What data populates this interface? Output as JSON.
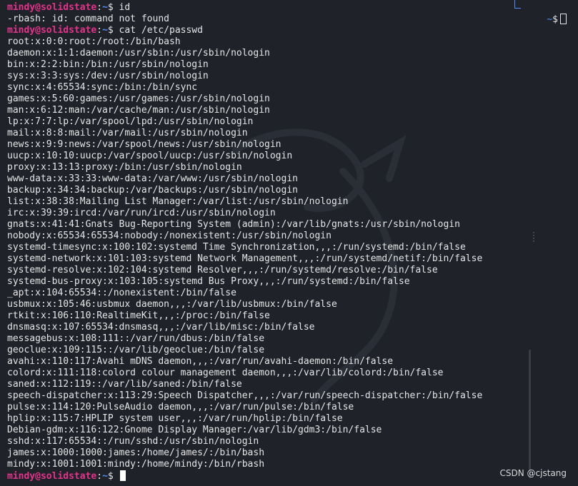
{
  "colors": {
    "background": "#1f2229",
    "prompt_user": "#e3338b",
    "prompt_path": "#4f8cf4",
    "text": "#e6e6e6"
  },
  "prompt": {
    "user": "mindy",
    "at": "@",
    "host": "solidstate",
    "colon": ":",
    "path": "~",
    "symbol": "$"
  },
  "top_right_prompt": {
    "path": "~",
    "symbol": "$"
  },
  "session": [
    {
      "kind": "prompt",
      "command": " id"
    },
    {
      "kind": "output",
      "text": "-rbash: id: command not found"
    },
    {
      "kind": "prompt",
      "command": " cat /etc/passwd"
    },
    {
      "kind": "output",
      "text": "root:x:0:0:root:/root:/bin/bash"
    },
    {
      "kind": "output",
      "text": "daemon:x:1:1:daemon:/usr/sbin:/usr/sbin/nologin"
    },
    {
      "kind": "output",
      "text": "bin:x:2:2:bin:/bin:/usr/sbin/nologin"
    },
    {
      "kind": "output",
      "text": "sys:x:3:3:sys:/dev:/usr/sbin/nologin"
    },
    {
      "kind": "output",
      "text": "sync:x:4:65534:sync:/bin:/bin/sync"
    },
    {
      "kind": "output",
      "text": "games:x:5:60:games:/usr/games:/usr/sbin/nologin"
    },
    {
      "kind": "output",
      "text": "man:x:6:12:man:/var/cache/man:/usr/sbin/nologin"
    },
    {
      "kind": "output",
      "text": "lp:x:7:7:lp:/var/spool/lpd:/usr/sbin/nologin"
    },
    {
      "kind": "output",
      "text": "mail:x:8:8:mail:/var/mail:/usr/sbin/nologin"
    },
    {
      "kind": "output",
      "text": "news:x:9:9:news:/var/spool/news:/usr/sbin/nologin"
    },
    {
      "kind": "output",
      "text": "uucp:x:10:10:uucp:/var/spool/uucp:/usr/sbin/nologin"
    },
    {
      "kind": "output",
      "text": "proxy:x:13:13:proxy:/bin:/usr/sbin/nologin"
    },
    {
      "kind": "output",
      "text": "www-data:x:33:33:www-data:/var/www:/usr/sbin/nologin"
    },
    {
      "kind": "output",
      "text": "backup:x:34:34:backup:/var/backups:/usr/sbin/nologin"
    },
    {
      "kind": "output",
      "text": "list:x:38:38:Mailing List Manager:/var/list:/usr/sbin/nologin"
    },
    {
      "kind": "output",
      "text": "irc:x:39:39:ircd:/var/run/ircd:/usr/sbin/nologin"
    },
    {
      "kind": "output",
      "text": "gnats:x:41:41:Gnats Bug-Reporting System (admin):/var/lib/gnats:/usr/sbin/nologin"
    },
    {
      "kind": "output",
      "text": "nobody:x:65534:65534:nobody:/nonexistent:/usr/sbin/nologin"
    },
    {
      "kind": "output",
      "text": "systemd-timesync:x:100:102:systemd Time Synchronization,,,:/run/systemd:/bin/false"
    },
    {
      "kind": "output",
      "text": "systemd-network:x:101:103:systemd Network Management,,,:/run/systemd/netif:/bin/false"
    },
    {
      "kind": "output",
      "text": "systemd-resolve:x:102:104:systemd Resolver,,,:/run/systemd/resolve:/bin/false"
    },
    {
      "kind": "output",
      "text": "systemd-bus-proxy:x:103:105:systemd Bus Proxy,,,:/run/systemd:/bin/false"
    },
    {
      "kind": "output",
      "text": "_apt:x:104:65534::/nonexistent:/bin/false"
    },
    {
      "kind": "output",
      "text": "usbmux:x:105:46:usbmux daemon,,,:/var/lib/usbmux:/bin/false"
    },
    {
      "kind": "output",
      "text": "rtkit:x:106:110:RealtimeKit,,,:/proc:/bin/false"
    },
    {
      "kind": "output",
      "text": "dnsmasq:x:107:65534:dnsmasq,,,:/var/lib/misc:/bin/false"
    },
    {
      "kind": "output",
      "text": "messagebus:x:108:111::/var/run/dbus:/bin/false"
    },
    {
      "kind": "output",
      "text": "geoclue:x:109:115::/var/lib/geoclue:/bin/false"
    },
    {
      "kind": "output",
      "text": "avahi:x:110:117:Avahi mDNS daemon,,,:/var/run/avahi-daemon:/bin/false"
    },
    {
      "kind": "output",
      "text": "colord:x:111:118:colord colour management daemon,,,:/var/lib/colord:/bin/false"
    },
    {
      "kind": "output",
      "text": "saned:x:112:119::/var/lib/saned:/bin/false"
    },
    {
      "kind": "output",
      "text": "speech-dispatcher:x:113:29:Speech Dispatcher,,,:/var/run/speech-dispatcher:/bin/false"
    },
    {
      "kind": "output",
      "text": "pulse:x:114:120:PulseAudio daemon,,,:/var/run/pulse:/bin/false"
    },
    {
      "kind": "output",
      "text": "hplip:x:115:7:HPLIP system user,,,:/var/run/hplip:/bin/false"
    },
    {
      "kind": "output",
      "text": "Debian-gdm:x:116:122:Gnome Display Manager:/var/lib/gdm3:/bin/false"
    },
    {
      "kind": "output",
      "text": "sshd:x:117:65534::/run/sshd:/usr/sbin/nologin"
    },
    {
      "kind": "output",
      "text": "james:x:1000:1000:james:/home/james/:/bin/bash"
    },
    {
      "kind": "output",
      "text": "mindy:x:1001:1001:mindy:/home/mindy:/bin/rbash"
    },
    {
      "kind": "prompt",
      "command": " ",
      "cursor": true
    }
  ],
  "watermark": "CSDN @cjstang",
  "icons": [
    "dragon-watermark-icon",
    "cursor-block-icon",
    "scrollbar-thumb"
  ]
}
